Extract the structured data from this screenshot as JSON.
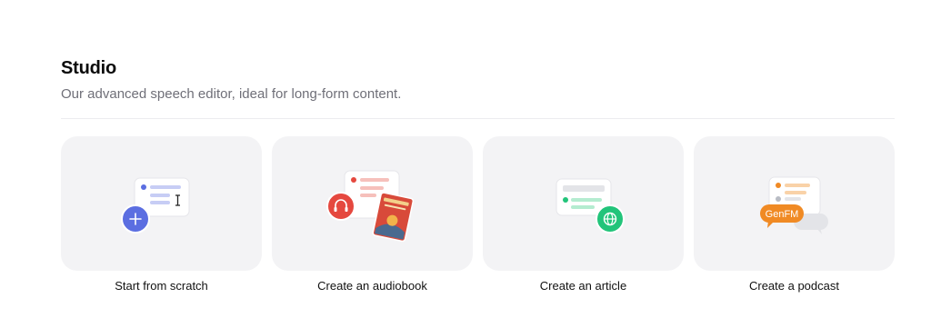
{
  "section": {
    "title": "Studio",
    "subtitle": "Our advanced speech editor, ideal for long-form content."
  },
  "cards": [
    {
      "label": "Start from scratch",
      "icon": "plus-icon"
    },
    {
      "label": "Create an audiobook",
      "icon": "headphones-icon"
    },
    {
      "label": "Create an article",
      "icon": "globe-icon"
    },
    {
      "label": "Create a podcast",
      "icon": "genfm-badge",
      "badge_text": "GenFM"
    }
  ],
  "colors": {
    "blue": "#5b6ee1",
    "red": "#e5483f",
    "green": "#22c47a",
    "orange": "#f08a24",
    "tile": "#f3f3f5"
  }
}
